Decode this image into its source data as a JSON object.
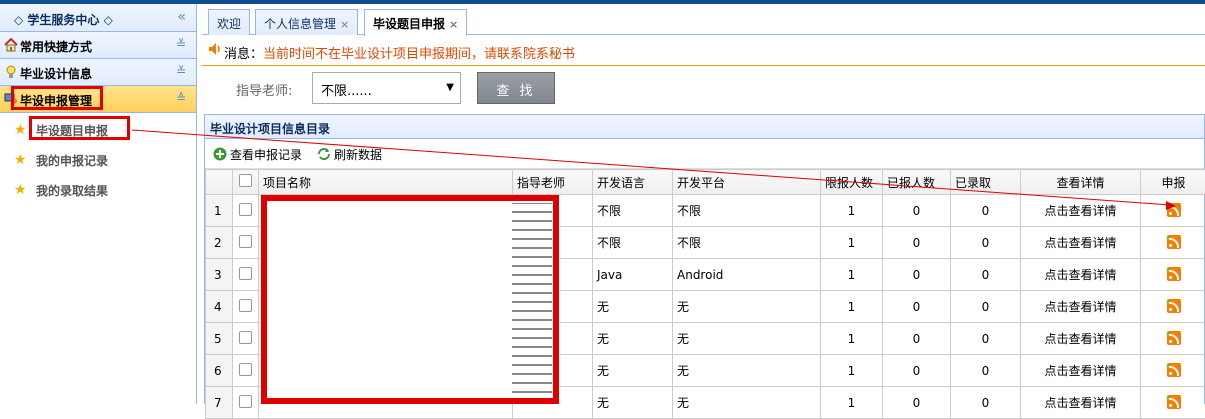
{
  "sidebar": {
    "title": "学生服务中心",
    "panels": [
      {
        "label": "常用快捷方式"
      },
      {
        "label": "毕业设计信息"
      },
      {
        "label": "毕设申报管理"
      }
    ],
    "items": [
      {
        "label": "毕设题目申报"
      },
      {
        "label": "我的申报记录"
      },
      {
        "label": "我的录取结果"
      }
    ]
  },
  "tabs": [
    {
      "label": "欢迎"
    },
    {
      "label": "个人信息管理"
    },
    {
      "label": "毕设题目申报"
    }
  ],
  "message": {
    "prefix": "消息：",
    "text": "当前时间不在毕业设计项目申报期间，请联系院系秘书"
  },
  "filter": {
    "label": "指导老师:",
    "selected": "不限......",
    "search_button": "查 找"
  },
  "grid": {
    "title": "毕业设计项目信息目录",
    "toolbar": {
      "view_records": "查看申报记录",
      "refresh": "刷新数据"
    },
    "columns": [
      "项目名称",
      "指导老师",
      "开发语言",
      "开发平台",
      "限报人数",
      "已报人数",
      "已录取",
      "查看详情",
      "申报"
    ],
    "rows": [
      {
        "num": "1",
        "lang": "不限",
        "platform": "不限",
        "limit": "1",
        "applied": "0",
        "admitted": "0",
        "detail": "点击查看详情"
      },
      {
        "num": "2",
        "lang": "不限",
        "platform": "不限",
        "limit": "1",
        "applied": "0",
        "admitted": "0",
        "detail": "点击查看详情"
      },
      {
        "num": "3",
        "lang": "Java",
        "platform": "Android",
        "limit": "1",
        "applied": "0",
        "admitted": "0",
        "detail": "点击查看详情"
      },
      {
        "num": "4",
        "lang": "无",
        "platform": "无",
        "limit": "1",
        "applied": "0",
        "admitted": "0",
        "detail": "点击查看详情"
      },
      {
        "num": "5",
        "lang": "无",
        "platform": "无",
        "limit": "1",
        "applied": "0",
        "admitted": "0",
        "detail": "点击查看详情"
      },
      {
        "num": "6",
        "lang": "无",
        "platform": "无",
        "limit": "1",
        "applied": "0",
        "admitted": "0",
        "detail": "点击查看详情"
      },
      {
        "num": "7",
        "lang": "无",
        "platform": "无",
        "limit": "1",
        "applied": "0",
        "admitted": "0",
        "detail": "点击查看详情"
      }
    ]
  },
  "colors": {
    "accent_blue": "#95b8e7",
    "active_panel": "#ffd05a",
    "annotation_red": "#e00000",
    "warning_text": "#e04800"
  }
}
